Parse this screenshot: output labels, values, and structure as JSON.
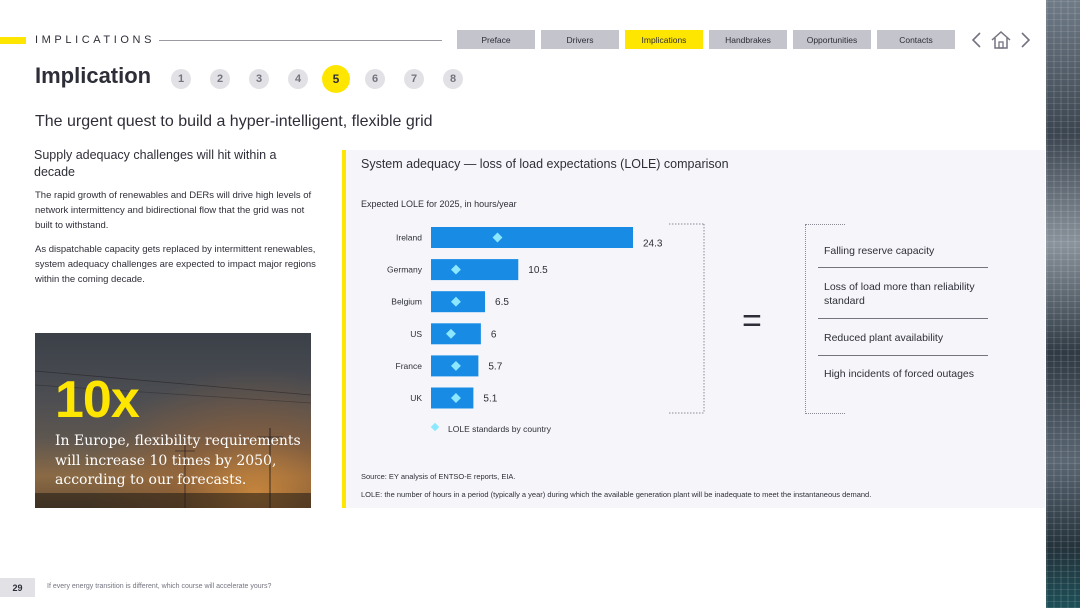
{
  "header": {
    "section_label": "IMPLICATIONS",
    "nav_tabs": [
      "Preface",
      "Drivers",
      "Implications",
      "Handbrakes",
      "Opportunities",
      "Contacts"
    ],
    "active_tab": "Implications",
    "nav_icons": [
      "chevron-left-icon",
      "home-icon",
      "chevron-right-icon"
    ]
  },
  "title_row": {
    "title": "Implication",
    "steps": [
      "1",
      "2",
      "3",
      "4",
      "5",
      "6",
      "7",
      "8"
    ],
    "active_step": "5"
  },
  "subtitle": "The urgent quest to build a hyper-intelligent, flexible grid",
  "left": {
    "heading": "Supply adequacy challenges will hit within a decade",
    "para1": "The rapid growth of renewables and DERs will drive high levels of network intermittency and bidirectional flow that the grid was not built to withstand.",
    "para2": "As dispatchable capacity gets replaced by intermittent renewables, system adequacy challenges are expected to impact major regions within the coming decade.",
    "stat_value": "10x",
    "stat_caption": "In Europe, flexibility requirements will increase 10 times by 2050, according to our forecasts."
  },
  "chart_panel": {
    "title": "System adequacy — loss of load expectations (LOLE) comparison",
    "equals": "=",
    "impacts": [
      "Falling reserve capacity",
      "Loss of load more than reliability standard",
      "Reduced plant availability",
      "High incidents of forced outages"
    ],
    "source": "Source: EY analysis of ENTSO-E reports, EIA.",
    "lole_note": "LOLE: the number of hours in a period (typically a year) during which the available generation plant will be inadequate to meet the instantaneous demand."
  },
  "chart_data": {
    "type": "bar",
    "orientation": "horizontal",
    "title": "Expected LOLE for 2025, in hours/year",
    "categories": [
      "Ireland",
      "Germany",
      "Belgium",
      "US",
      "France",
      "UK"
    ],
    "values": [
      24.3,
      10.5,
      6.5,
      6,
      5.7,
      5.1
    ],
    "value_labels": [
      "24.3",
      "10.5",
      "6.5",
      "6",
      "5.7",
      "5.1"
    ],
    "series": [
      {
        "name": "Expected LOLE",
        "values": [
          24.3,
          10.5,
          6.5,
          6,
          5.7,
          5.1
        ]
      },
      {
        "name": "LOLE standards by country",
        "values": [
          8,
          3,
          3,
          2.4,
          3,
          3
        ]
      }
    ],
    "legend": [
      "LOLE standards by country"
    ],
    "xlim": [
      0,
      24.3
    ],
    "bar_color": "#188ce5",
    "marker_color": "#8ce8ff",
    "grid": false
  },
  "footer": {
    "page_number": "29",
    "text": "If every energy transition is different, which course will accelerate yours?"
  },
  "colors": {
    "accent": "#ffe600",
    "text": "#2e2e38",
    "tab": "#c4c4cd",
    "panel": "#f6f6fa"
  }
}
